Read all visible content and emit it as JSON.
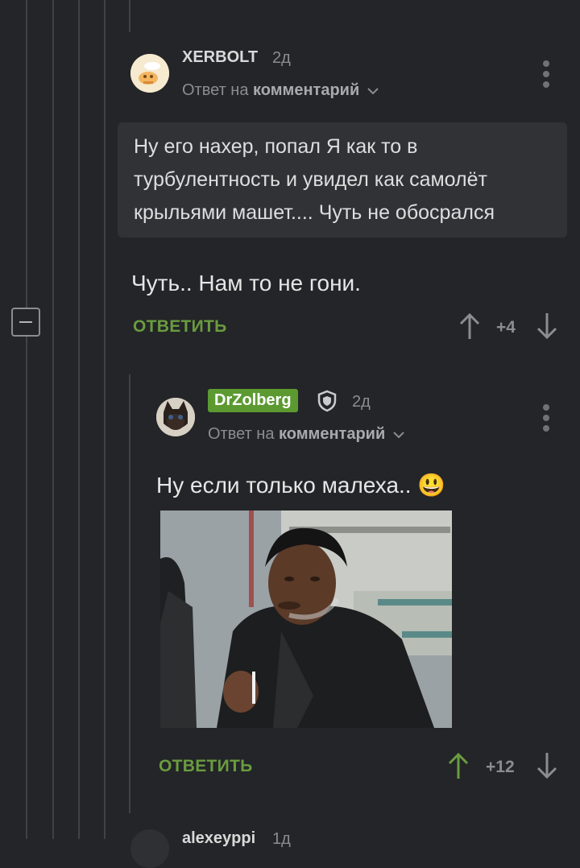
{
  "comment1": {
    "username": "XERBOLT",
    "time": "2д",
    "reply_prefix": "Ответ на",
    "reply_target": "комментарий",
    "quote": "Ну его нахер, попал Я как то в турбулентность и увидел как самолёт крыльями машет.... Чуть не обосрался",
    "text": "Чуть.. Нам то не гони.",
    "reply_label": "ОТВЕТИТЬ",
    "score": "+4"
  },
  "comment2": {
    "username": "DrZolberg",
    "time": "2д",
    "reply_prefix": "Ответ на",
    "reply_target": "комментарий",
    "text": "Ну если только малеха..",
    "emoji": "😃",
    "reply_label": "ОТВЕТИТЬ",
    "score": "+12"
  },
  "comment3": {
    "username": "alexeyppi",
    "time": "1д"
  },
  "colors": {
    "background": "#232528",
    "accent_green": "#6a9c3f",
    "badge_green": "#5c9a31",
    "muted": "#8a8d91"
  }
}
